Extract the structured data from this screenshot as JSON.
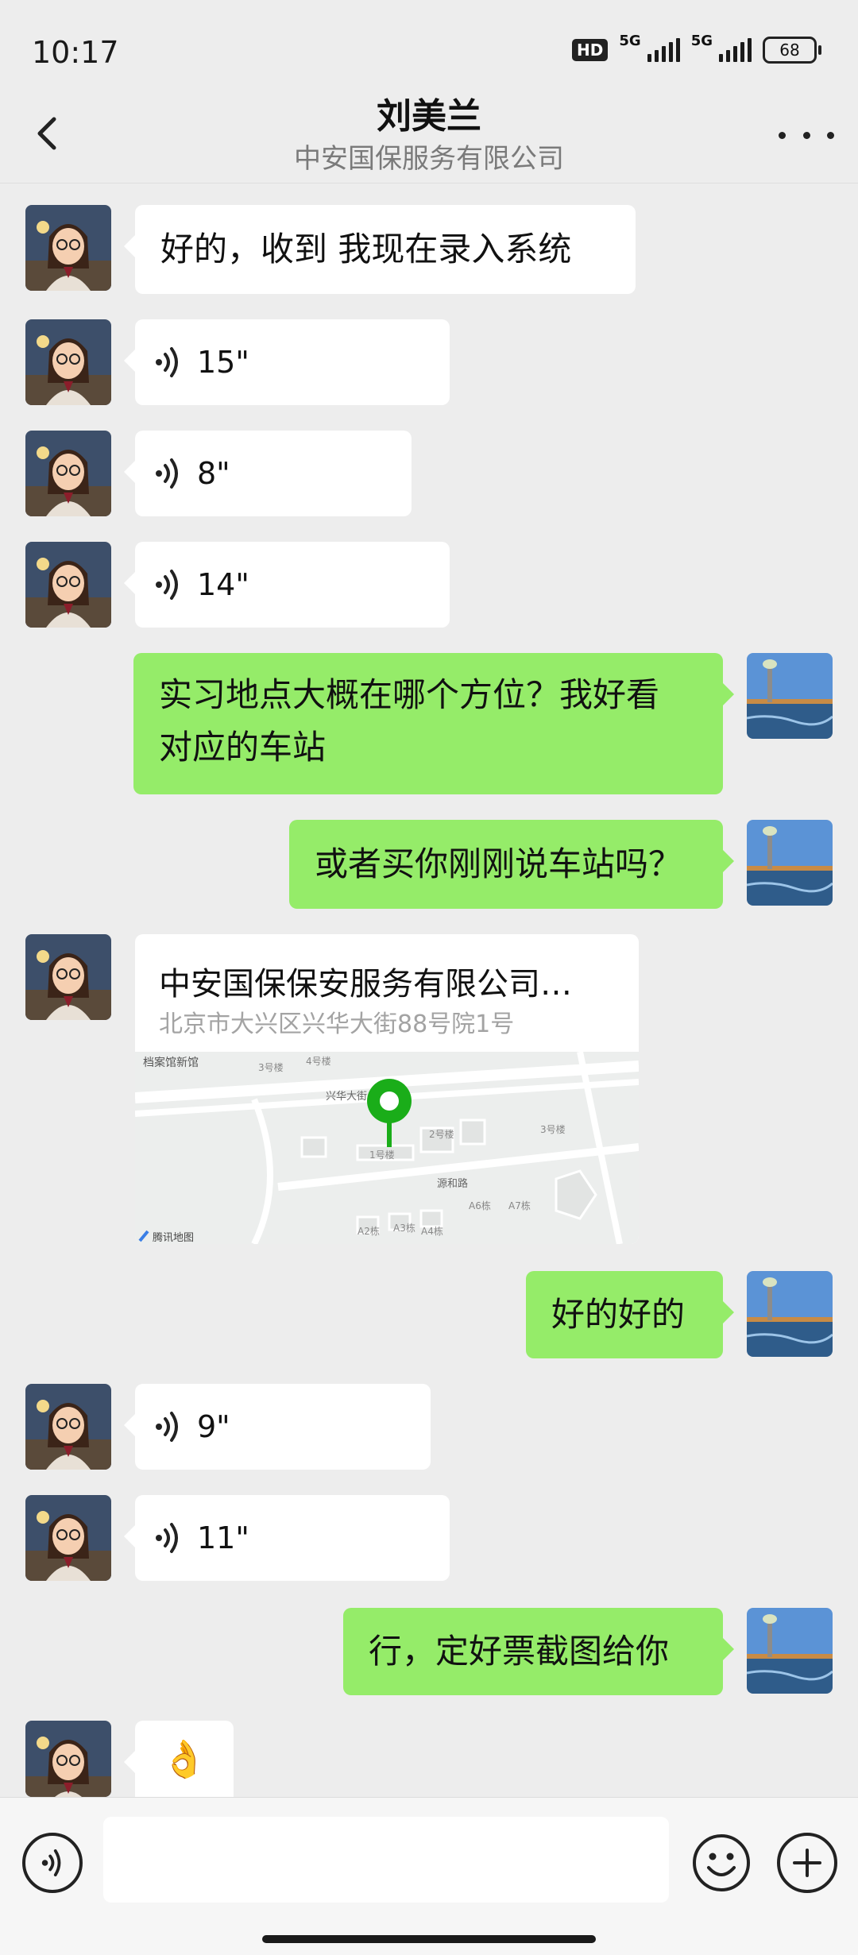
{
  "status": {
    "time": "10:17",
    "hd": "HD",
    "net1": "5G",
    "net2": "5G",
    "battery": "68"
  },
  "header": {
    "title": "刘美兰",
    "subtitle": "中安国保服务有限公司",
    "back_icon": "back-arrow-icon",
    "more_icon": "more-dots-icon"
  },
  "messages": [
    {
      "type": "text",
      "side": "in",
      "text": "好的，收到 我现在录入系统"
    },
    {
      "type": "voice",
      "side": "in",
      "duration": "15\""
    },
    {
      "type": "voice",
      "side": "in",
      "duration": "8\""
    },
    {
      "type": "voice",
      "side": "in",
      "duration": "14\""
    },
    {
      "type": "text",
      "side": "out",
      "line1": "实习地点大概在哪个方位？我好看",
      "line2": "对应的车站"
    },
    {
      "type": "text",
      "side": "out",
      "text": "或者买你刚刚说车站吗？"
    },
    {
      "type": "location",
      "side": "in",
      "title": "中安国保保安服务有限公司…",
      "address": "北京市大兴区兴华大街88号院1号",
      "map_labels": {
        "archive": "档案馆新馆",
        "b3": "3号楼",
        "b4": "4号楼",
        "road1": "兴华大街",
        "b2": "2号楼",
        "b3b": "3号楼",
        "b1": "1号楼",
        "road2": "源和路",
        "a6": "A6栋",
        "a7": "A7栋",
        "a2": "A2栋",
        "a3": "A3栋",
        "a4": "A4栋",
        "brand": "腾讯地图"
      }
    },
    {
      "type": "text",
      "side": "out",
      "text": "好的好的"
    },
    {
      "type": "voice",
      "side": "in",
      "duration": "9\""
    },
    {
      "type": "voice",
      "side": "in",
      "duration": "11\""
    },
    {
      "type": "text",
      "side": "out",
      "text": "行，定好票截图给你"
    },
    {
      "type": "emoji",
      "side": "in",
      "text": "👌"
    }
  ],
  "input": {
    "value": "",
    "voice_icon": "voice-input-icon",
    "emoji_icon": "emoji-icon",
    "plus_icon": "plus-icon"
  },
  "colors": {
    "background": "#ededed",
    "incoming": "#ffffff",
    "outgoing": "#95ec69",
    "pin": "#1aad19"
  }
}
